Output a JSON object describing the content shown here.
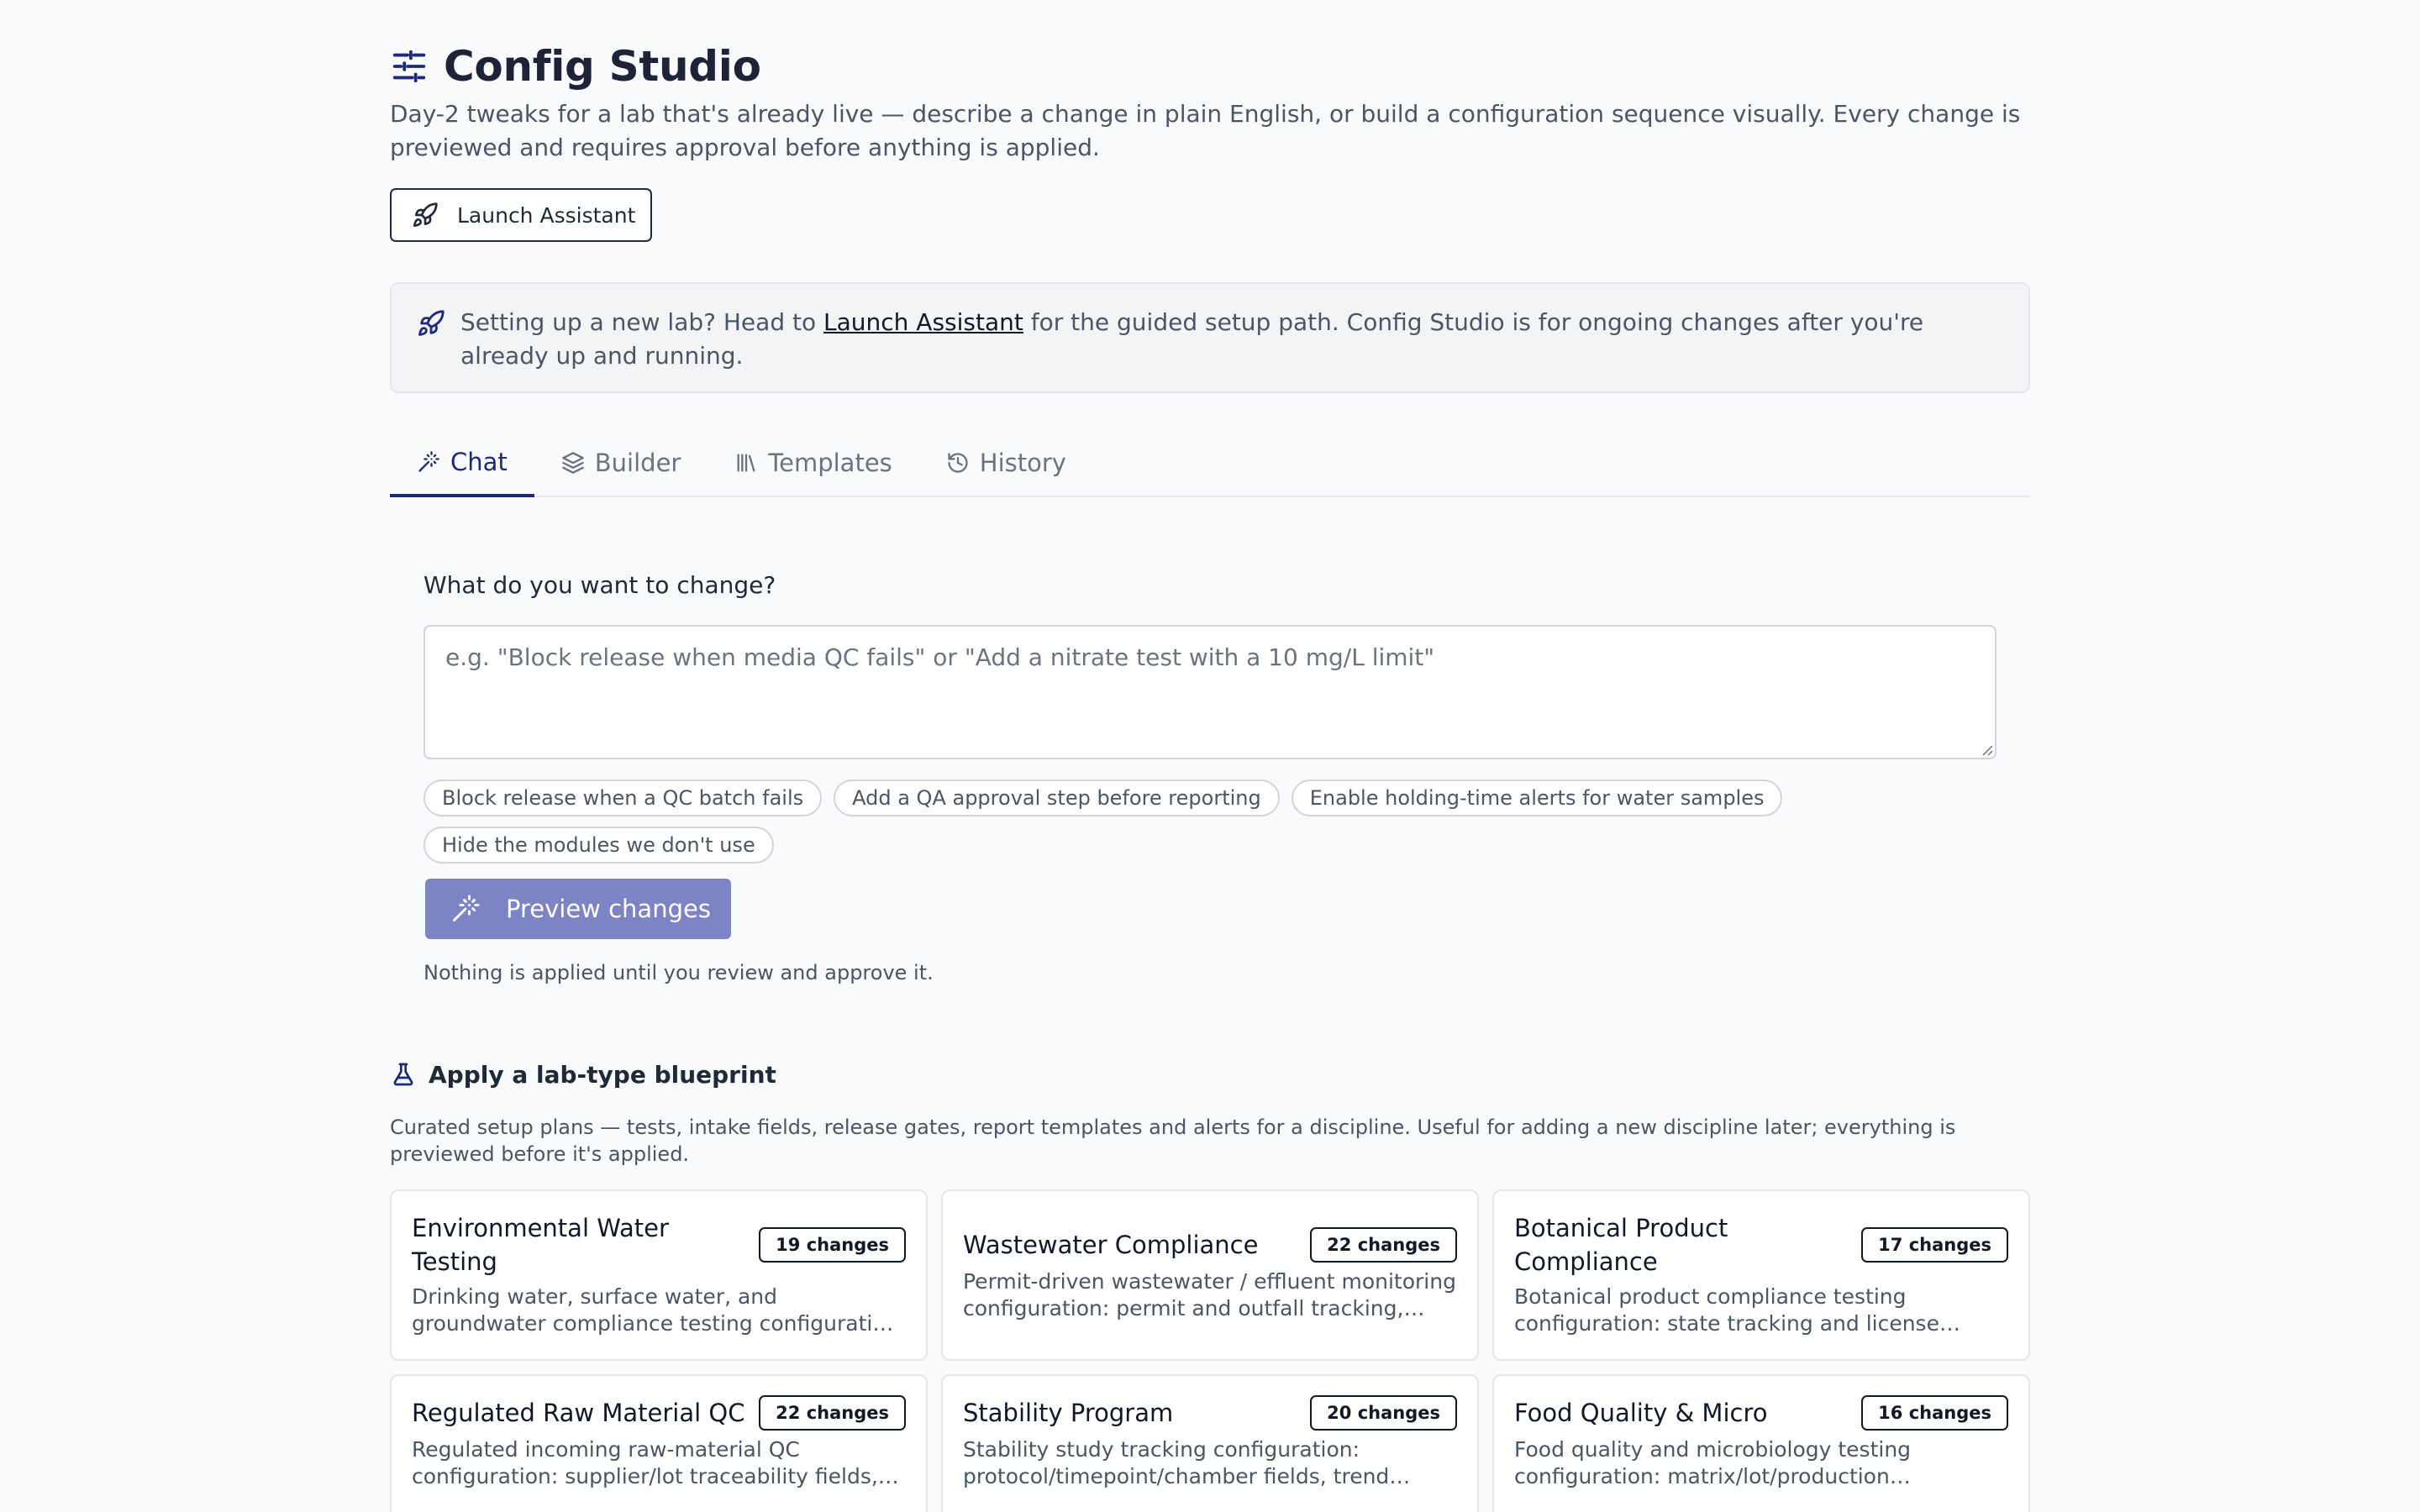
{
  "header": {
    "title": "Config Studio",
    "subtitle": "Day-2 tweaks for a lab that's already live — describe a change in plain English, or build a configuration sequence visually. Every change is previewed and requires approval before anything is applied.",
    "launch_button": "Launch Assistant"
  },
  "notice": {
    "pre": "Setting up a new lab? Head to ",
    "link": "Launch Assistant",
    "post": " for the guided setup path. Config Studio is for ongoing changes after you're already up and running."
  },
  "tabs": [
    {
      "label": "Chat",
      "icon": "wand-icon",
      "active": true
    },
    {
      "label": "Builder",
      "icon": "layers-icon",
      "active": false
    },
    {
      "label": "Templates",
      "icon": "library-icon",
      "active": false
    },
    {
      "label": "History",
      "icon": "history-icon",
      "active": false
    }
  ],
  "chat": {
    "question": "What do you want to change?",
    "placeholder": "e.g. \"Block release when media QC fails\" or \"Add a nitrate test with a 10 mg/L limit\"",
    "value": "",
    "suggestions": [
      "Block release when a QC batch fails",
      "Add a QA approval step before reporting",
      "Enable holding-time alerts for water samples",
      "Hide the modules we don't use"
    ],
    "preview_button": "Preview changes",
    "hint": "Nothing is applied until you review and approve it."
  },
  "blueprint": {
    "heading": "Apply a lab-type blueprint",
    "description": "Curated setup plans — tests, intake fields, release gates, report templates and alerts for a discipline. Useful for adding a new discipline later; everything is previewed before it's applied.",
    "cards": [
      {
        "title": "Environmental Water Testing",
        "badge": "19 changes",
        "desc": "Drinking water, surface water, and groundwater compliance testing configuration: custody…"
      },
      {
        "title": "Wastewater Compliance",
        "badge": "22 changes",
        "desc": "Permit-driven wastewater / effluent monitoring configuration: permit and outfall tracking,…"
      },
      {
        "title": "Botanical Product Compliance",
        "badge": "17 changes",
        "desc": "Botanical product compliance testing configuration: state tracking and license…"
      },
      {
        "title": "Regulated Raw Material QC",
        "badge": "22 changes",
        "desc": "Regulated incoming raw-material QC configuration: supplier/lot traceability fields,…"
      },
      {
        "title": "Stability Program",
        "badge": "20 changes",
        "desc": "Stability study tracking configuration: protocol/timepoint/chamber fields, trend…"
      },
      {
        "title": "Food Quality & Micro",
        "badge": "16 changes",
        "desc": "Food quality and microbiology testing configuration: matrix/lot/production tracking,…"
      }
    ]
  },
  "colors": {
    "accent": "#1e2a78",
    "preview_button_bg": "#7c84c6",
    "page_bg": "#f9fafb"
  }
}
